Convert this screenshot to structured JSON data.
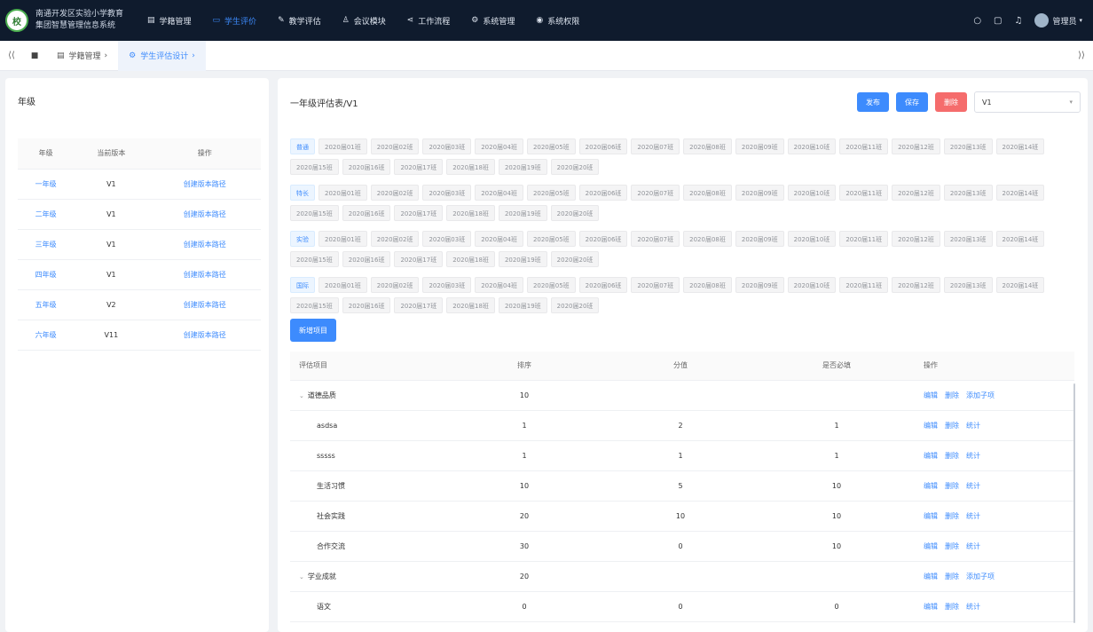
{
  "app": {
    "title_line1": "南通开发区实验小学教育",
    "title_line2": "集团智慧管理信息系统",
    "logo": "校"
  },
  "nav": [
    {
      "icon": "▤",
      "label": "学籍管理",
      "active": false
    },
    {
      "icon": "▭",
      "label": "学生评价",
      "active": true
    },
    {
      "icon": "✎",
      "label": "教学评估",
      "active": false
    },
    {
      "icon": "♙",
      "label": "会议模块",
      "active": false
    },
    {
      "icon": "⋖",
      "label": "工作流程",
      "active": false
    },
    {
      "icon": "⚙",
      "label": "系统管理",
      "active": false
    },
    {
      "icon": "◉",
      "label": "系统权限",
      "active": false
    }
  ],
  "top_right": {
    "user": "管理员"
  },
  "tabs": {
    "t1": "学籍管理",
    "t2": "学生评估设计"
  },
  "left": {
    "title": "年级",
    "headers": [
      "年级",
      "当前版本",
      "操作"
    ],
    "rows": [
      {
        "grade": "一年级",
        "version": "V1",
        "op": "创建版本路径"
      },
      {
        "grade": "二年级",
        "version": "V1",
        "op": "创建版本路径"
      },
      {
        "grade": "三年级",
        "version": "V1",
        "op": "创建版本路径"
      },
      {
        "grade": "四年级",
        "version": "V1",
        "op": "创建版本路径"
      },
      {
        "grade": "五年级",
        "version": "V2",
        "op": "创建版本路径"
      },
      {
        "grade": "六年级",
        "version": "V11",
        "op": "创建版本路径"
      }
    ]
  },
  "right": {
    "title": "一年级评估表/V1",
    "btn_publish": "发布",
    "btn_save": "保存",
    "btn_delete": "删除",
    "version_value": "V1",
    "tag_groups": [
      {
        "label": "普通",
        "tags": [
          "2020届01班",
          "2020届02班",
          "2020届03班",
          "2020届04班",
          "2020届05班",
          "2020届06班",
          "2020届07班",
          "2020届08班",
          "2020届09班",
          "2020届10班",
          "2020届11班",
          "2020届12班",
          "2020届13班",
          "2020届14班",
          "2020届15班",
          "2020届16班",
          "2020届17班",
          "2020届18班",
          "2020届19班",
          "2020届20班"
        ]
      },
      {
        "label": "特长",
        "tags": [
          "2020届01班",
          "2020届02班",
          "2020届03班",
          "2020届04班",
          "2020届05班",
          "2020届06班",
          "2020届07班",
          "2020届08班",
          "2020届09班",
          "2020届10班",
          "2020届11班",
          "2020届12班",
          "2020届13班",
          "2020届14班",
          "2020届15班",
          "2020届16班",
          "2020届17班",
          "2020届18班",
          "2020届19班",
          "2020届20班"
        ]
      },
      {
        "label": "实验",
        "tags": [
          "2020届01班",
          "2020届02班",
          "2020届03班",
          "2020届04班",
          "2020届05班",
          "2020届06班",
          "2020届07班",
          "2020届08班",
          "2020届09班",
          "2020届10班",
          "2020届11班",
          "2020届12班",
          "2020届13班",
          "2020届14班",
          "2020届15班",
          "2020届16班",
          "2020届17班",
          "2020届18班",
          "2020届19班",
          "2020届20班"
        ]
      },
      {
        "label": "国际",
        "tags": [
          "2020届01班",
          "2020届02班",
          "2020届03班",
          "2020届04班",
          "2020届05班",
          "2020届06班",
          "2020届07班",
          "2020届08班",
          "2020届09班",
          "2020届10班",
          "2020届11班",
          "2020届12班",
          "2020届13班",
          "2020届14班",
          "2020届15班",
          "2020届16班",
          "2020届17班",
          "2020届18班",
          "2020届19班",
          "2020届20班"
        ]
      }
    ],
    "add_btn": "新增项目",
    "table_headers": [
      "评估项目",
      "排序",
      "分值",
      "是否必填",
      "操作"
    ],
    "rows": [
      {
        "name": "道德品质",
        "level": 0,
        "order": "10",
        "score": "",
        "req": "",
        "ops": [
          "编辑",
          "删除",
          "添加子项"
        ]
      },
      {
        "name": "asdsa",
        "level": 1,
        "order": "1",
        "score": "2",
        "req": "1",
        "ops": [
          "编辑",
          "删除",
          "统计"
        ]
      },
      {
        "name": "sssss",
        "level": 1,
        "order": "1",
        "score": "1",
        "req": "1",
        "ops": [
          "编辑",
          "删除",
          "统计"
        ]
      },
      {
        "name": "生活习惯",
        "level": 1,
        "order": "10",
        "score": "5",
        "req": "10",
        "ops": [
          "编辑",
          "删除",
          "统计"
        ]
      },
      {
        "name": "社会实践",
        "level": 1,
        "order": "20",
        "score": "10",
        "req": "10",
        "ops": [
          "编辑",
          "删除",
          "统计"
        ]
      },
      {
        "name": "合作交流",
        "level": 1,
        "order": "30",
        "score": "0",
        "req": "10",
        "ops": [
          "编辑",
          "删除",
          "统计"
        ]
      },
      {
        "name": "学业成就",
        "level": 0,
        "order": "20",
        "score": "",
        "req": "",
        "ops": [
          "编辑",
          "删除",
          "添加子项"
        ]
      },
      {
        "name": "语文",
        "level": 1,
        "order": "0",
        "score": "0",
        "req": "0",
        "ops": [
          "编辑",
          "删除",
          "统计"
        ]
      }
    ]
  }
}
